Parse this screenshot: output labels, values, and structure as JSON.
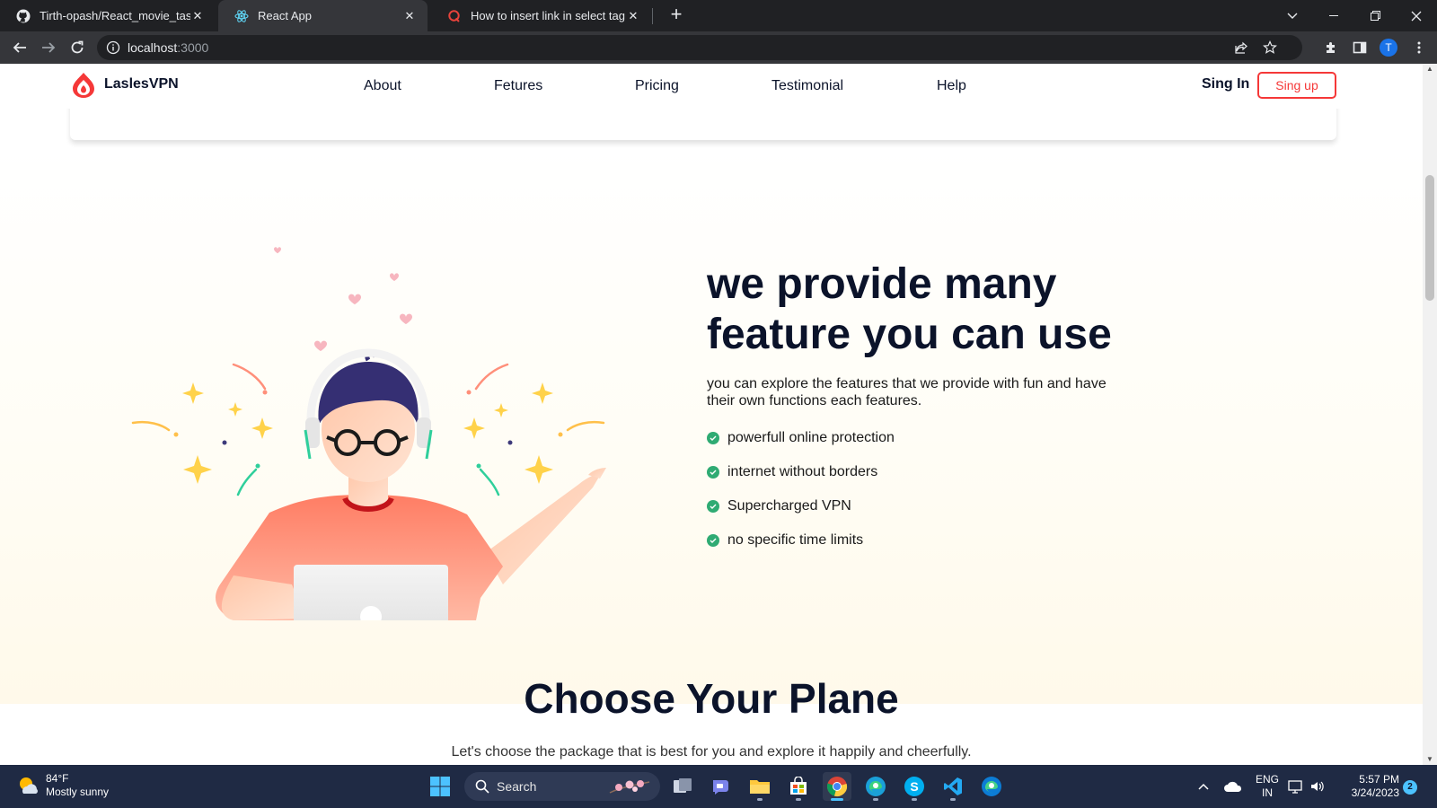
{
  "browser": {
    "tabs": [
      {
        "title": "Tirth-opash/React_movie_task",
        "icon": "github-icon",
        "active": false
      },
      {
        "title": "React App",
        "icon": "react-icon",
        "active": true
      },
      {
        "title": "How to insert link in select tag in",
        "icon": "quora-icon",
        "active": false
      }
    ],
    "address": {
      "host": "localhost",
      "port": ":3000"
    },
    "profile_initial": "T"
  },
  "site": {
    "logo_text": "LaslesVPN",
    "nav": [
      "About",
      "Fetures",
      "Pricing",
      "Testimonial",
      "Help"
    ],
    "signin_label": "Sing In",
    "signup_label": "Sing up",
    "brand_color": "#F53838",
    "check_color": "#2FAB73"
  },
  "features": {
    "title_line1": "we provide many",
    "title_line2": "feature you can use",
    "description": "you can explore the features that we provide with fun and have their own functions each features.",
    "items": [
      "powerfull online protection",
      "internet without borders",
      "Supercharged VPN",
      "no specific time limits"
    ]
  },
  "plans": {
    "title": "Choose Your Plane",
    "subtitle": "Let's choose the package that is best for you and explore it happily and cheerfully."
  },
  "taskbar": {
    "weather_temp": "84°F",
    "weather_desc": "Mostly sunny",
    "search_label": "Search",
    "lang_top": "ENG",
    "lang_bottom": "IN",
    "time": "5:57 PM",
    "date": "3/24/2023",
    "notification_count": "2"
  }
}
